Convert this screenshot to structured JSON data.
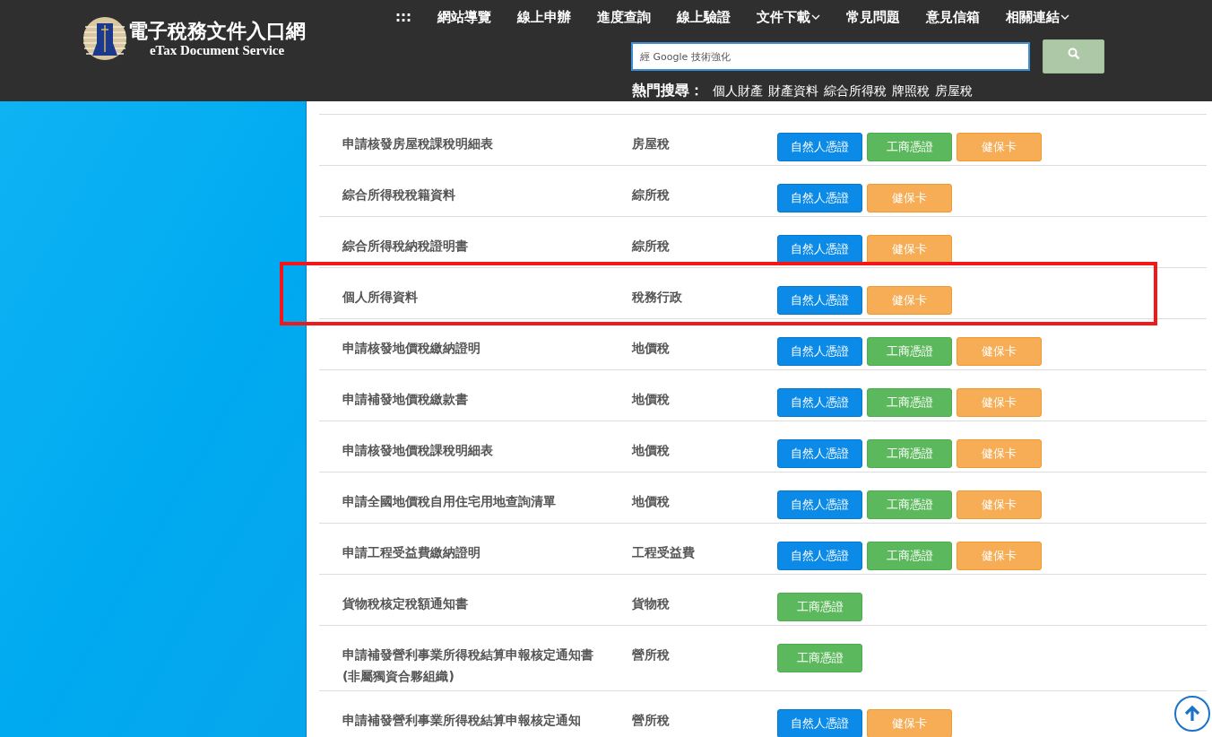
{
  "header": {
    "site_title": "電子稅務文件入口網",
    "site_subtitle": "eTax Document Service",
    "nav": [
      {
        "label": ":::",
        "dropdown": false
      },
      {
        "label": "網站導覽",
        "dropdown": false
      },
      {
        "label": "線上申辦",
        "dropdown": false
      },
      {
        "label": "進度查詢",
        "dropdown": false
      },
      {
        "label": "線上驗證",
        "dropdown": false
      },
      {
        "label": "文件下載",
        "dropdown": true
      },
      {
        "label": "常見問題",
        "dropdown": false
      },
      {
        "label": "意見信箱",
        "dropdown": false
      },
      {
        "label": "相關連結",
        "dropdown": true
      }
    ],
    "search": {
      "placeholder": "經 Google 技術強化"
    },
    "hot_search": {
      "label": "熱門搜尋：",
      "terms": [
        "個人財產",
        "財產資料",
        "綜合所得稅",
        "牌照稅",
        "房屋稅"
      ]
    }
  },
  "rows": [
    {
      "name": "申請核發房屋稅課稅明細表",
      "tax": "房屋稅",
      "highlighted": false,
      "buttons": [
        {
          "kind": "natural",
          "label": "自然人憑證"
        },
        {
          "kind": "business",
          "label": "工商憑證"
        },
        {
          "kind": "health",
          "label": "健保卡"
        }
      ]
    },
    {
      "name": "綜合所得稅稅籍資料",
      "tax": "綜所稅",
      "highlighted": false,
      "buttons": [
        {
          "kind": "natural",
          "label": "自然人憑證"
        },
        {
          "kind": "health",
          "label": "健保卡"
        }
      ]
    },
    {
      "name": "綜合所得稅納稅證明書",
      "tax": "綜所稅",
      "highlighted": false,
      "buttons": [
        {
          "kind": "natural",
          "label": "自然人憑證"
        },
        {
          "kind": "health",
          "label": "健保卡"
        }
      ]
    },
    {
      "name": "個人所得資料",
      "tax": "稅務行政",
      "highlighted": true,
      "buttons": [
        {
          "kind": "natural",
          "label": "自然人憑證"
        },
        {
          "kind": "health",
          "label": "健保卡"
        }
      ]
    },
    {
      "name": "申請核發地價稅繳納證明",
      "tax": "地價稅",
      "highlighted": false,
      "buttons": [
        {
          "kind": "natural",
          "label": "自然人憑證"
        },
        {
          "kind": "business",
          "label": "工商憑證"
        },
        {
          "kind": "health",
          "label": "健保卡"
        }
      ]
    },
    {
      "name": "申請補發地價稅繳款書",
      "tax": "地價稅",
      "highlighted": false,
      "buttons": [
        {
          "kind": "natural",
          "label": "自然人憑證"
        },
        {
          "kind": "business",
          "label": "工商憑證"
        },
        {
          "kind": "health",
          "label": "健保卡"
        }
      ]
    },
    {
      "name": "申請核發地價稅課稅明細表",
      "tax": "地價稅",
      "highlighted": false,
      "buttons": [
        {
          "kind": "natural",
          "label": "自然人憑證"
        },
        {
          "kind": "business",
          "label": "工商憑證"
        },
        {
          "kind": "health",
          "label": "健保卡"
        }
      ]
    },
    {
      "name": "申請全國地價稅自用住宅用地查詢清單",
      "tax": "地價稅",
      "highlighted": false,
      "buttons": [
        {
          "kind": "natural",
          "label": "自然人憑證"
        },
        {
          "kind": "business",
          "label": "工商憑證"
        },
        {
          "kind": "health",
          "label": "健保卡"
        }
      ]
    },
    {
      "name": "申請工程受益費繳納證明",
      "tax": "工程受益費",
      "highlighted": false,
      "buttons": [
        {
          "kind": "natural",
          "label": "自然人憑證"
        },
        {
          "kind": "business",
          "label": "工商憑證"
        },
        {
          "kind": "health",
          "label": "健保卡"
        }
      ]
    },
    {
      "name": "貨物稅核定稅額通知書",
      "tax": "貨物稅",
      "highlighted": false,
      "buttons": [
        {
          "kind": "business",
          "label": "工商憑證"
        }
      ]
    },
    {
      "name": "申請補發營利事業所得稅結算申報核定通知書(非屬獨資合夥組織)",
      "tax": "營所稅",
      "highlighted": false,
      "buttons": [
        {
          "kind": "business",
          "label": "工商憑證"
        }
      ]
    },
    {
      "name": "申請補發營利事業所得稅結算申報核定通知",
      "tax": "營所稅",
      "highlighted": false,
      "buttons": [
        {
          "kind": "natural",
          "label": "自然人憑證"
        },
        {
          "kind": "health",
          "label": "健保卡"
        }
      ]
    }
  ]
}
